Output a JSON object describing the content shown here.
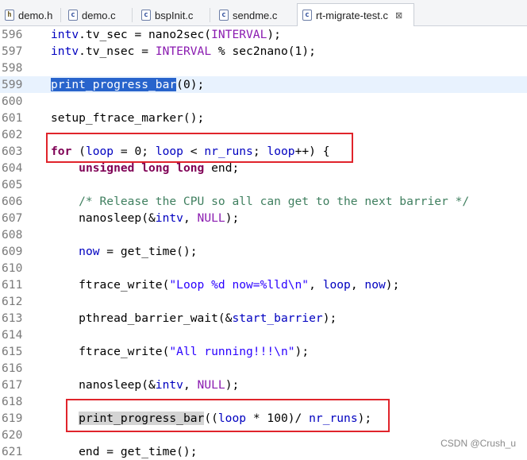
{
  "tabs": [
    {
      "label": "demo.h",
      "icon": "h-file-icon"
    },
    {
      "label": "demo.c",
      "icon": "c-file-icon"
    },
    {
      "label": "bspInit.c",
      "icon": "c-file-icon"
    },
    {
      "label": "sendme.c",
      "icon": "c-file-icon"
    },
    {
      "label": "rt-migrate-test.c",
      "icon": "c-file-icon",
      "active": true,
      "close": "⊠"
    }
  ],
  "lines": [
    {
      "n": "596",
      "code": "intv.tv_sec = nano2sec(INTERVAL);"
    },
    {
      "n": "597",
      "code": "intv.tv_nsec = INTERVAL % sec2nano(1);"
    },
    {
      "n": "598",
      "code": ""
    },
    {
      "n": "599",
      "code": "print_progress_bar(0);"
    },
    {
      "n": "600",
      "code": ""
    },
    {
      "n": "601",
      "code": "setup_ftrace_marker();"
    },
    {
      "n": "602",
      "code": ""
    },
    {
      "n": "603",
      "code": "for (loop = 0; loop < nr_runs; loop++) {"
    },
    {
      "n": "604",
      "code": "    unsigned long long end;"
    },
    {
      "n": "605",
      "code": ""
    },
    {
      "n": "606",
      "code": "    /* Release the CPU so all can get to the next barrier */"
    },
    {
      "n": "607",
      "code": "    nanosleep(&intv, NULL);"
    },
    {
      "n": "608",
      "code": ""
    },
    {
      "n": "609",
      "code": "    now = get_time();"
    },
    {
      "n": "610",
      "code": ""
    },
    {
      "n": "611",
      "code": "    ftrace_write(\"Loop %d now=%lld\\n\", loop, now);"
    },
    {
      "n": "612",
      "code": ""
    },
    {
      "n": "613",
      "code": "    pthread_barrier_wait(&start_barrier);"
    },
    {
      "n": "614",
      "code": ""
    },
    {
      "n": "615",
      "code": "    ftrace_write(\"All running!!!\\n\");"
    },
    {
      "n": "616",
      "code": ""
    },
    {
      "n": "617",
      "code": "    nanosleep(&intv, NULL);"
    },
    {
      "n": "618",
      "code": ""
    },
    {
      "n": "619",
      "code": "    print_progress_bar((loop * 100)/ nr_runs);"
    },
    {
      "n": "620",
      "code": ""
    },
    {
      "n": "621",
      "code": "    end = get_time();"
    }
  ],
  "watermark": "CSDN @Crush_u",
  "colors": {
    "annotation_box": "#e0242b",
    "selection": "#2864cc",
    "current_line": "#e8f2fe"
  }
}
